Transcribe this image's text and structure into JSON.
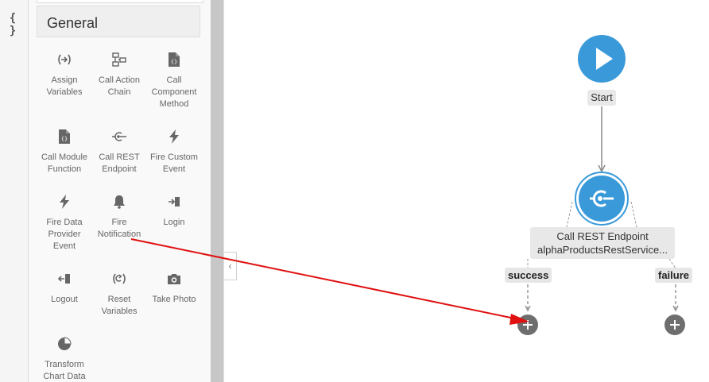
{
  "rail": {
    "icon": "{ }"
  },
  "palette": {
    "section_title": "General",
    "items": [
      {
        "label": "Assign Variables",
        "icon": "assign-icon"
      },
      {
        "label": "Call Action Chain",
        "icon": "action-chain-icon"
      },
      {
        "label": "Call Component Method",
        "icon": "component-method-icon"
      },
      {
        "label": "Call Module Function",
        "icon": "module-function-icon"
      },
      {
        "label": "Call REST Endpoint",
        "icon": "rest-endpoint-icon"
      },
      {
        "label": "Fire Custom Event",
        "icon": "lightning-icon"
      },
      {
        "label": "Fire Data Provider Event",
        "icon": "lightning-icon"
      },
      {
        "label": "Fire Notification",
        "icon": "bell-icon"
      },
      {
        "label": "Login",
        "icon": "login-icon"
      },
      {
        "label": "Logout",
        "icon": "logout-icon"
      },
      {
        "label": "Reset Variables",
        "icon": "reset-icon"
      },
      {
        "label": "Take Photo",
        "icon": "camera-icon"
      },
      {
        "label": "Transform Chart Data",
        "icon": "pie-chart-icon"
      }
    ]
  },
  "canvas": {
    "start_label": "Start",
    "rest_node": {
      "title": "Call REST Endpoint",
      "subtitle": "alphaProductsRestService..."
    },
    "branches": {
      "success": "success",
      "failure": "failure"
    }
  },
  "colors": {
    "accent": "#3a9ad9",
    "arrow": "#e01010"
  }
}
